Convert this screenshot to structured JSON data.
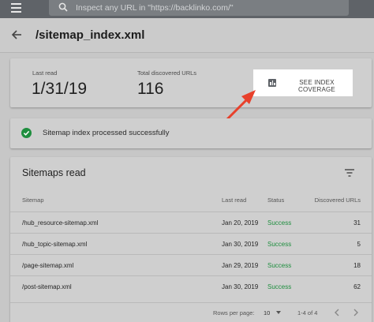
{
  "search": {
    "placeholder": "Inspect any URL in \"https://backlinko.com/\""
  },
  "header": {
    "title": "/sitemap_index.xml"
  },
  "stats": {
    "last_read_label": "Last read",
    "last_read_value": "1/31/19",
    "total_label": "Total discovered URLs",
    "total_value": "116",
    "coverage_button": "SEE INDEX COVERAGE"
  },
  "status": {
    "message": "Sitemap index processed successfully"
  },
  "table": {
    "title": "Sitemaps read",
    "columns": [
      "Sitemap",
      "Last read",
      "Status",
      "Discovered URLs"
    ],
    "rows": [
      {
        "sitemap": "/hub_resource-sitemap.xml",
        "last_read": "Jan 20, 2019",
        "status": "Success",
        "urls": "31"
      },
      {
        "sitemap": "/hub_topic-sitemap.xml",
        "last_read": "Jan 30, 2019",
        "status": "Success",
        "urls": "5"
      },
      {
        "sitemap": "/page-sitemap.xml",
        "last_read": "Jan 29, 2019",
        "status": "Success",
        "urls": "18"
      },
      {
        "sitemap": "/post-sitemap.xml",
        "last_read": "Jan 30, 2019",
        "status": "Success",
        "urls": "62"
      }
    ],
    "footer": {
      "rows_per_page_label": "Rows per page:",
      "rows_per_page_value": "10",
      "range": "1-4 of 4"
    }
  },
  "colors": {
    "success": "#1e8e3e",
    "arrow": "#e8412c",
    "topbar": "#5f6368"
  },
  "icons": [
    "menu-icon",
    "search-icon",
    "back-icon",
    "bar-chart-icon",
    "check-circle-icon",
    "filter-icon",
    "chevron-left-icon",
    "chevron-right-icon"
  ]
}
